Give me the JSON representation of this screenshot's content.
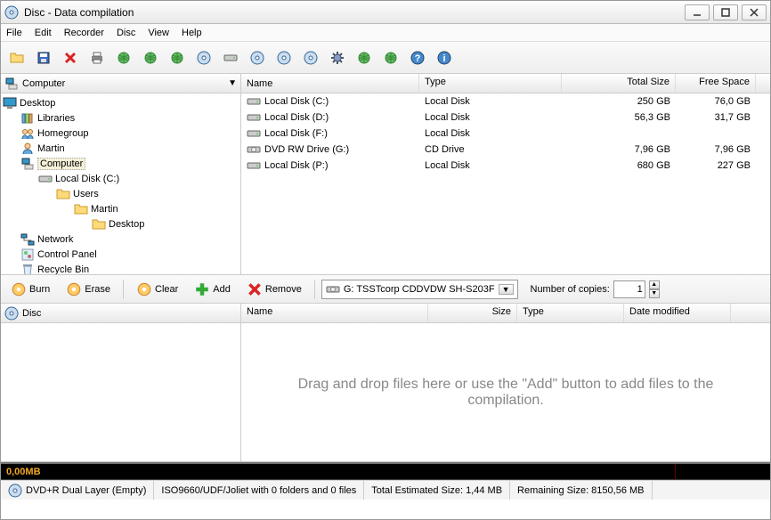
{
  "window": {
    "title": "Disc - Data compilation"
  },
  "menu": [
    "File",
    "Edit",
    "Recorder",
    "Disc",
    "View",
    "Help"
  ],
  "tree": {
    "header": "Computer",
    "items": [
      {
        "label": "Desktop",
        "indent": 0,
        "icon": "monitor"
      },
      {
        "label": "Libraries",
        "indent": 1,
        "icon": "libraries"
      },
      {
        "label": "Homegroup",
        "indent": 1,
        "icon": "homegroup"
      },
      {
        "label": "Martin",
        "indent": 1,
        "icon": "user"
      },
      {
        "label": "Computer",
        "indent": 1,
        "icon": "computer",
        "selected": true
      },
      {
        "label": "Local Disk (C:)",
        "indent": 2,
        "icon": "drive"
      },
      {
        "label": "Users",
        "indent": 3,
        "icon": "folder"
      },
      {
        "label": "Martin",
        "indent": 4,
        "icon": "folder"
      },
      {
        "label": "Desktop",
        "indent": 5,
        "icon": "folder"
      },
      {
        "label": "Network",
        "indent": 1,
        "icon": "network"
      },
      {
        "label": "Control Panel",
        "indent": 1,
        "icon": "control"
      },
      {
        "label": "Recycle Bin",
        "indent": 1,
        "icon": "recycle"
      }
    ]
  },
  "list": {
    "columns": {
      "name": "Name",
      "type": "Type",
      "total": "Total Size",
      "free": "Free Space"
    },
    "rows": [
      {
        "name": "Local Disk (C:)",
        "type": "Local Disk",
        "total": "250 GB",
        "free": "76,0 GB",
        "icon": "drive"
      },
      {
        "name": "Local Disk (D:)",
        "type": "Local Disk",
        "total": "56,3 GB",
        "free": "31,7 GB",
        "icon": "drive"
      },
      {
        "name": "Local Disk (F:)",
        "type": "Local Disk",
        "total": "",
        "free": "",
        "icon": "drive"
      },
      {
        "name": "DVD RW Drive (G:)",
        "type": "CD Drive",
        "total": "7,96 GB",
        "free": "7,96 GB",
        "icon": "dvd"
      },
      {
        "name": "Local Disk (P:)",
        "type": "Local Disk",
        "total": "680 GB",
        "free": "227 GB",
        "icon": "drive"
      }
    ]
  },
  "actions": {
    "burn": "Burn",
    "erase": "Erase",
    "clear": "Clear",
    "add": "Add",
    "remove": "Remove",
    "drive_selected": "G: TSSTcorp CDDVDW SH-S203F",
    "copies_label": "Number of copies:",
    "copies_value": "1"
  },
  "disc_panel": {
    "label": "Disc"
  },
  "compilation": {
    "columns": {
      "name": "Name",
      "size": "Size",
      "type": "Type",
      "date": "Date modified"
    },
    "drop_hint": "Drag and drop files here or use the \"Add\" button to add files to the compilation."
  },
  "progress": {
    "label": "0,00MB"
  },
  "status": {
    "disc_type": "DVD+R Dual Layer (Empty)",
    "fs": "ISO9660/UDF/Joliet with 0 folders and 0 files",
    "est": "Total Estimated Size: 1,44 MB",
    "remain": "Remaining Size: 8150,56 MB"
  }
}
